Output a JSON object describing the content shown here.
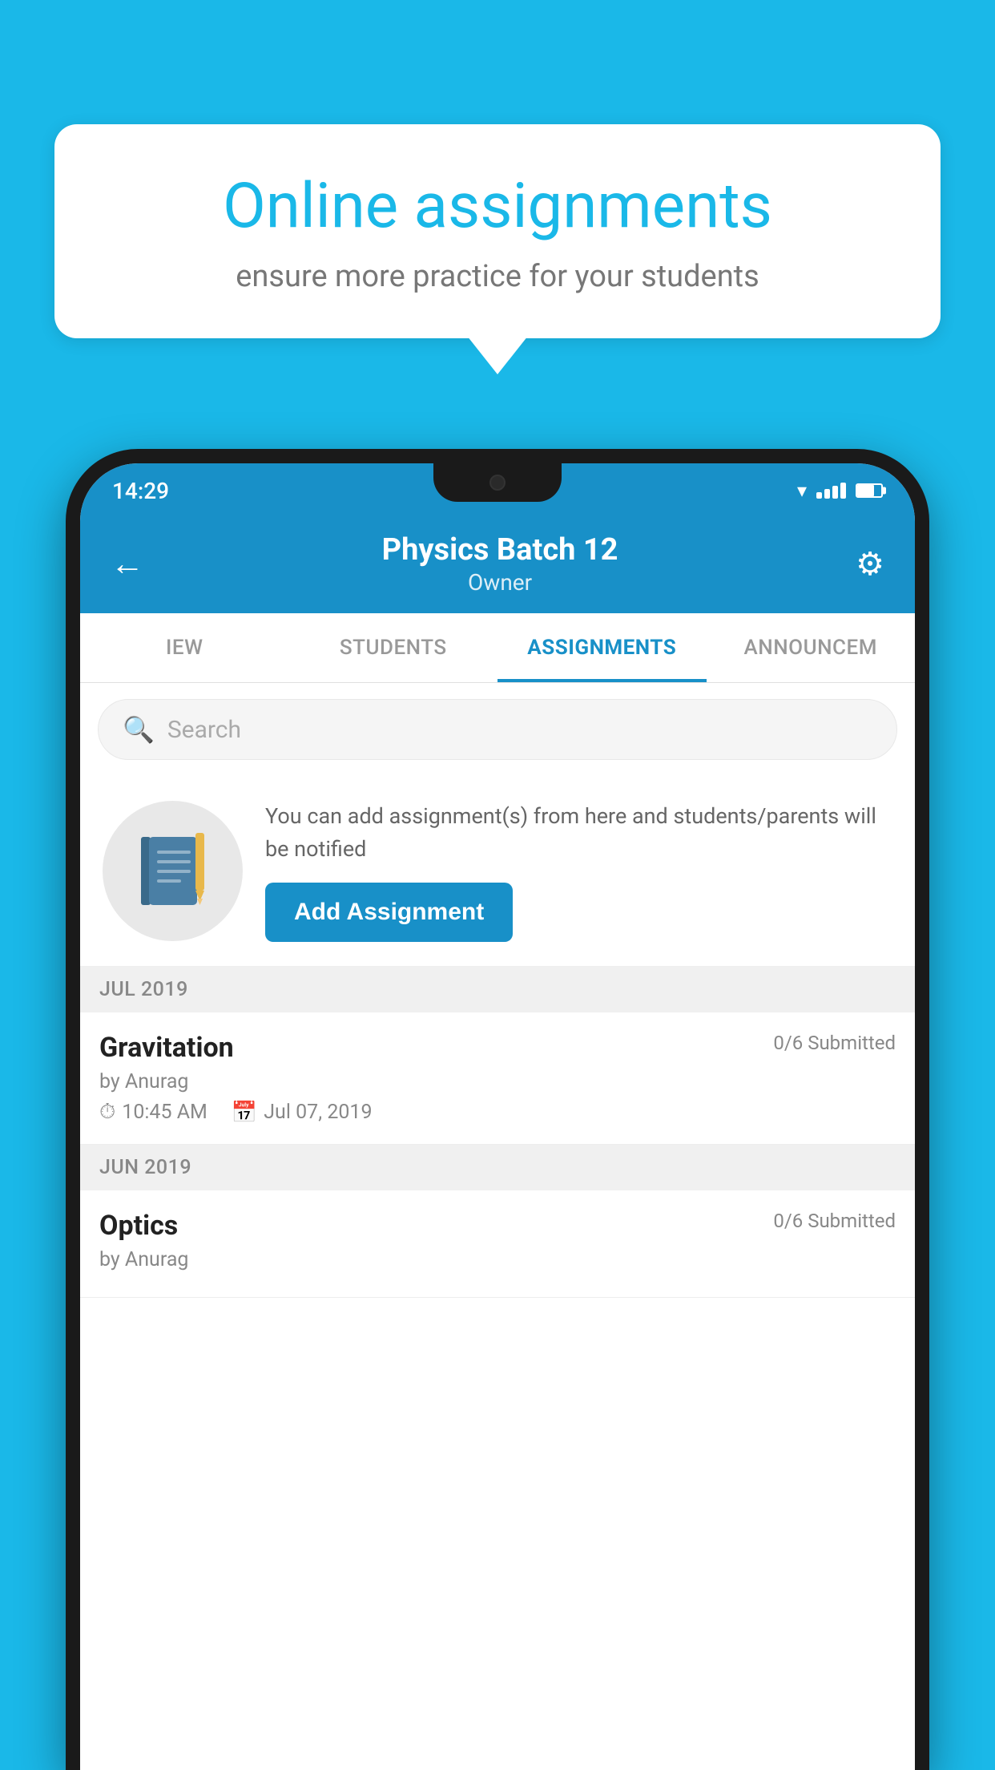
{
  "background_color": "#1ab8e8",
  "speech_bubble": {
    "title": "Online assignments",
    "subtitle": "ensure more practice for your students"
  },
  "status_bar": {
    "time": "14:29"
  },
  "header": {
    "title": "Physics Batch 12",
    "subtitle": "Owner",
    "back_label": "←",
    "settings_label": "⚙"
  },
  "tabs": [
    {
      "label": "IEW",
      "active": false
    },
    {
      "label": "STUDENTS",
      "active": false
    },
    {
      "label": "ASSIGNMENTS",
      "active": true
    },
    {
      "label": "ANNOUNCEM",
      "active": false
    }
  ],
  "search": {
    "placeholder": "Search"
  },
  "promo": {
    "description": "You can add assignment(s) from here and students/parents will be notified",
    "button_label": "Add Assignment"
  },
  "sections": [
    {
      "month": "JUL 2019",
      "assignments": [
        {
          "title": "Gravitation",
          "submitted": "0/6 Submitted",
          "author": "by Anurag",
          "time": "10:45 AM",
          "date": "Jul 07, 2019"
        }
      ]
    },
    {
      "month": "JUN 2019",
      "assignments": [
        {
          "title": "Optics",
          "submitted": "0/6 Submitted",
          "author": "by Anurag",
          "time": "",
          "date": ""
        }
      ]
    }
  ]
}
